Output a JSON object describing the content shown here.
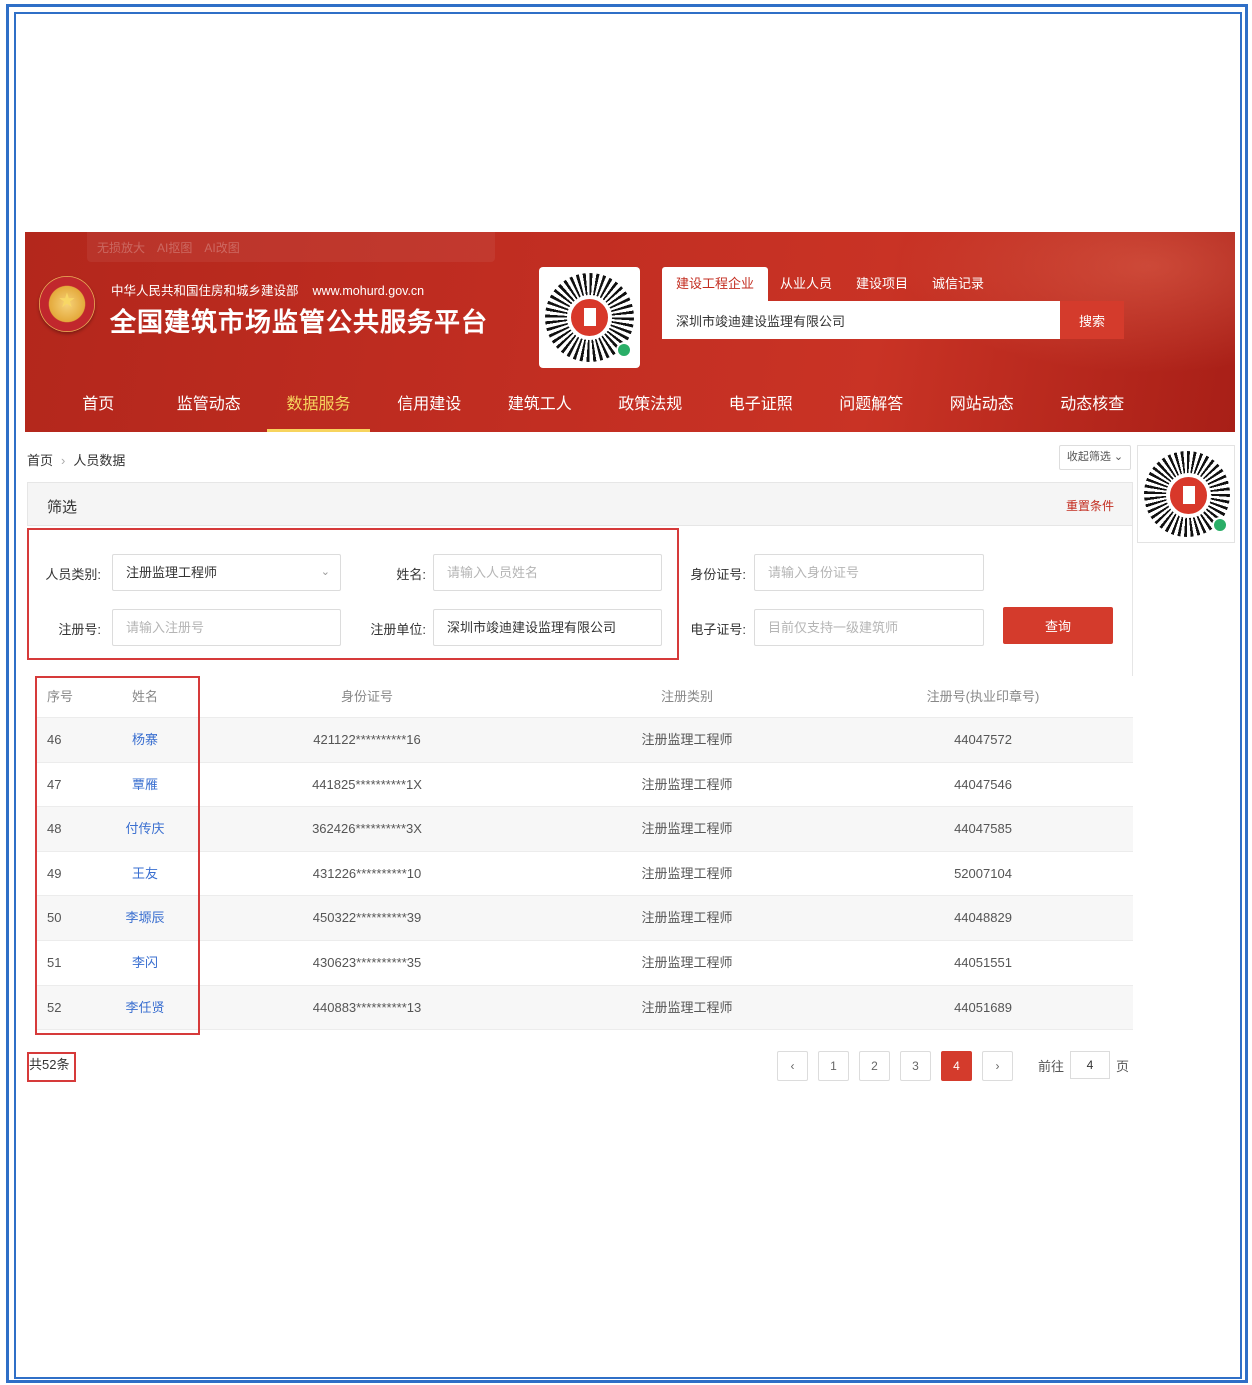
{
  "toolbar": {
    "items": [
      "无损放大",
      "AI抠图",
      "AI改图"
    ]
  },
  "header": {
    "org_name": "中华人民共和国住房和城乡建设部",
    "url": "www.mohurd.gov.cn",
    "title": "全国建筑市场监管公共服务平台"
  },
  "search": {
    "tabs": [
      "建设工程企业",
      "从业人员",
      "建设项目",
      "诚信记录"
    ],
    "active_tab": "建设工程企业",
    "value": "深圳市竣迪建设监理有限公司",
    "button": "搜索"
  },
  "nav": {
    "items": [
      "首页",
      "监管动态",
      "数据服务",
      "信用建设",
      "建筑工人",
      "政策法规",
      "电子证照",
      "问题解答",
      "网站动态",
      "动态核查"
    ],
    "active": "数据服务"
  },
  "breadcrumb": {
    "home": "首页",
    "current": "人员数据"
  },
  "collapse_label": "收起筛选",
  "filter": {
    "title": "筛选",
    "reset": "重置条件",
    "person_type_label": "人员类别:",
    "person_type_value": "注册监理工程师",
    "name_label": "姓名:",
    "name_placeholder": "请输入人员姓名",
    "id_label": "身份证号:",
    "id_placeholder": "请输入身份证号",
    "reg_no_label": "注册号:",
    "reg_no_placeholder": "请输入注册号",
    "reg_unit_label": "注册单位:",
    "reg_unit_value": "深圳市竣迪建设监理有限公司",
    "cert_label": "电子证号:",
    "cert_placeholder": "目前仅支持一级建筑师",
    "query_button": "查询"
  },
  "table": {
    "headers": [
      "序号",
      "姓名",
      "身份证号",
      "注册类别",
      "注册号(执业印章号)"
    ],
    "rows": [
      [
        "46",
        "杨寨",
        "421122**********16",
        "注册监理工程师",
        "44047572"
      ],
      [
        "47",
        "覃雁",
        "441825**********1X",
        "注册监理工程师",
        "44047546"
      ],
      [
        "48",
        "付传庆",
        "362426**********3X",
        "注册监理工程师",
        "44047585"
      ],
      [
        "49",
        "王友",
        "431226**********10",
        "注册监理工程师",
        "52007104"
      ],
      [
        "50",
        "李塬辰",
        "450322**********39",
        "注册监理工程师",
        "44048829"
      ],
      [
        "51",
        "李闪",
        "430623**********35",
        "注册监理工程师",
        "44051551"
      ],
      [
        "52",
        "李任贤",
        "440883**********13",
        "注册监理工程师",
        "44051689"
      ]
    ]
  },
  "pagination": {
    "total": "共52条",
    "prev": "‹",
    "pages": [
      "1",
      "2",
      "3",
      "4"
    ],
    "current": "4",
    "next": "›",
    "goto_label": "前往",
    "goto_value": "4",
    "goto_suffix": "页"
  },
  "colors": {
    "brand_red": "#c32d20",
    "highlight_box": "#d63a3a",
    "frame_blue": "#2f6fc7",
    "nav_active": "#f7d45e",
    "link": "#3a6fd0"
  }
}
